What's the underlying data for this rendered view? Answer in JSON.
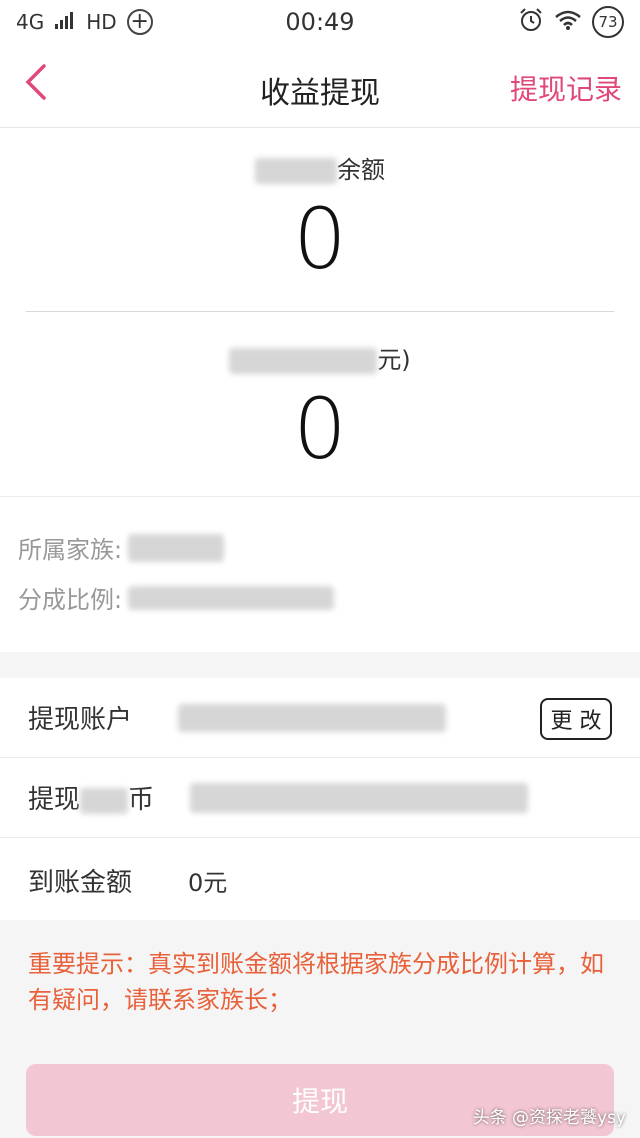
{
  "status_bar": {
    "network": "4G",
    "signal": "",
    "hd": "HD",
    "plus_icon": "+",
    "time": "00:49",
    "alarm_icon": "alarm-icon",
    "wifi_icon": "wifi-icon",
    "battery": "73"
  },
  "nav": {
    "back_glyph": "‹",
    "title": "收益提现",
    "right_action": "提现记录"
  },
  "balance": {
    "label_suffix": "余额",
    "value": "0"
  },
  "withdrawable": {
    "label_suffix": "元)",
    "value": "0"
  },
  "info": {
    "family_label": "所属家族:",
    "ratio_label": "分成比例:"
  },
  "form": {
    "account_label": "提现账户",
    "change_label": "更 改",
    "second_label_prefix": "提现",
    "second_label_suffix": "币",
    "arrival_label": "到账金额",
    "arrival_value": "0元"
  },
  "notice": "重要提示：真实到账金额将根据家族分成比例计算，如有疑问，请联系家族长；",
  "submit_label": "提现",
  "watermark": "头条 @资探老饕ysy",
  "colors": {
    "accent": "#e04878",
    "notice": "#e8613a",
    "button_disabled": "#f2c6d2"
  }
}
